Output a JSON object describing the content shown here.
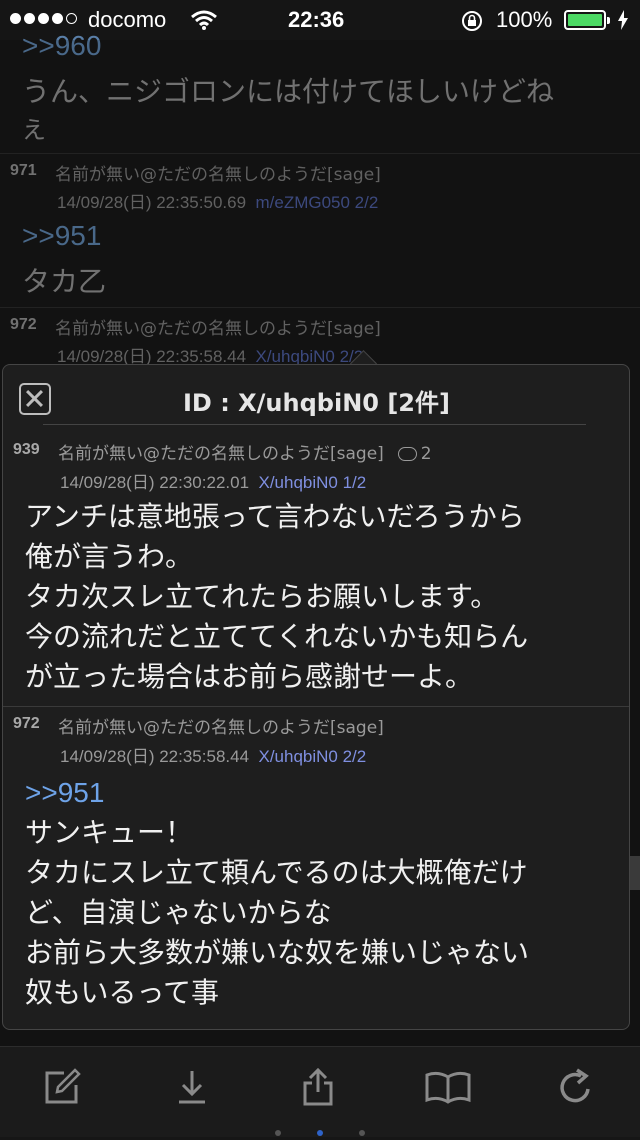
{
  "status_bar": {
    "carrier": "docomo",
    "time": "22:36",
    "battery": "100%"
  },
  "background_thread": {
    "top_anchor": ">>960",
    "top_line1": "うん、ニジゴロンには付けてほしいけどね",
    "top_line2": "え",
    "post_971": {
      "num": "971",
      "name": "名前が無い@ただの名無しのようだ[sage]",
      "date": "14/09/28(日) 22:35:50.69",
      "id": "m/eZMG050 2/2",
      "anchor": ">>951",
      "body": "タカ乙"
    },
    "post_972": {
      "num": "972",
      "name": "名前が無い@ただの名無しのようだ[sage]",
      "date": "14/09/28(日) 22:35:58.44",
      "id": "X/uhqbiN0 2/2"
    }
  },
  "popup": {
    "title": "ID : X/uhqbiN0 [2件]",
    "posts": [
      {
        "num": "939",
        "name": "名前が無い@ただの名無しのようだ[sage]",
        "reply_count": "2",
        "date": "14/09/28(日) 22:30:22.01",
        "id": "X/uhqbiN0 1/2",
        "lines": [
          "アンチは意地張って言わないだろうから",
          "俺が言うわ。",
          "タカ次スレ立てれたらお願いします。",
          "今の流れだと立ててくれないかも知らん",
          "が立った場合はお前ら感謝せーよ。"
        ]
      },
      {
        "num": "972",
        "name": "名前が無い@ただの名無しのようだ[sage]",
        "date": "14/09/28(日) 22:35:58.44",
        "id": "X/uhqbiN0 2/2",
        "anchor": ">>951",
        "lines": [
          "サンキュー！",
          "タカにスレ立て頼んでるのは大概俺だけ",
          "ど、自演じゃないからな",
          "お前ら大多数が嫌いな奴を嫌いじゃない",
          "奴もいるって事"
        ]
      }
    ]
  },
  "toolbar": {
    "icons": [
      "compose-icon",
      "download-icon",
      "share-icon",
      "bookmark-icon",
      "refresh-icon"
    ],
    "accent": "#2e63c9"
  }
}
